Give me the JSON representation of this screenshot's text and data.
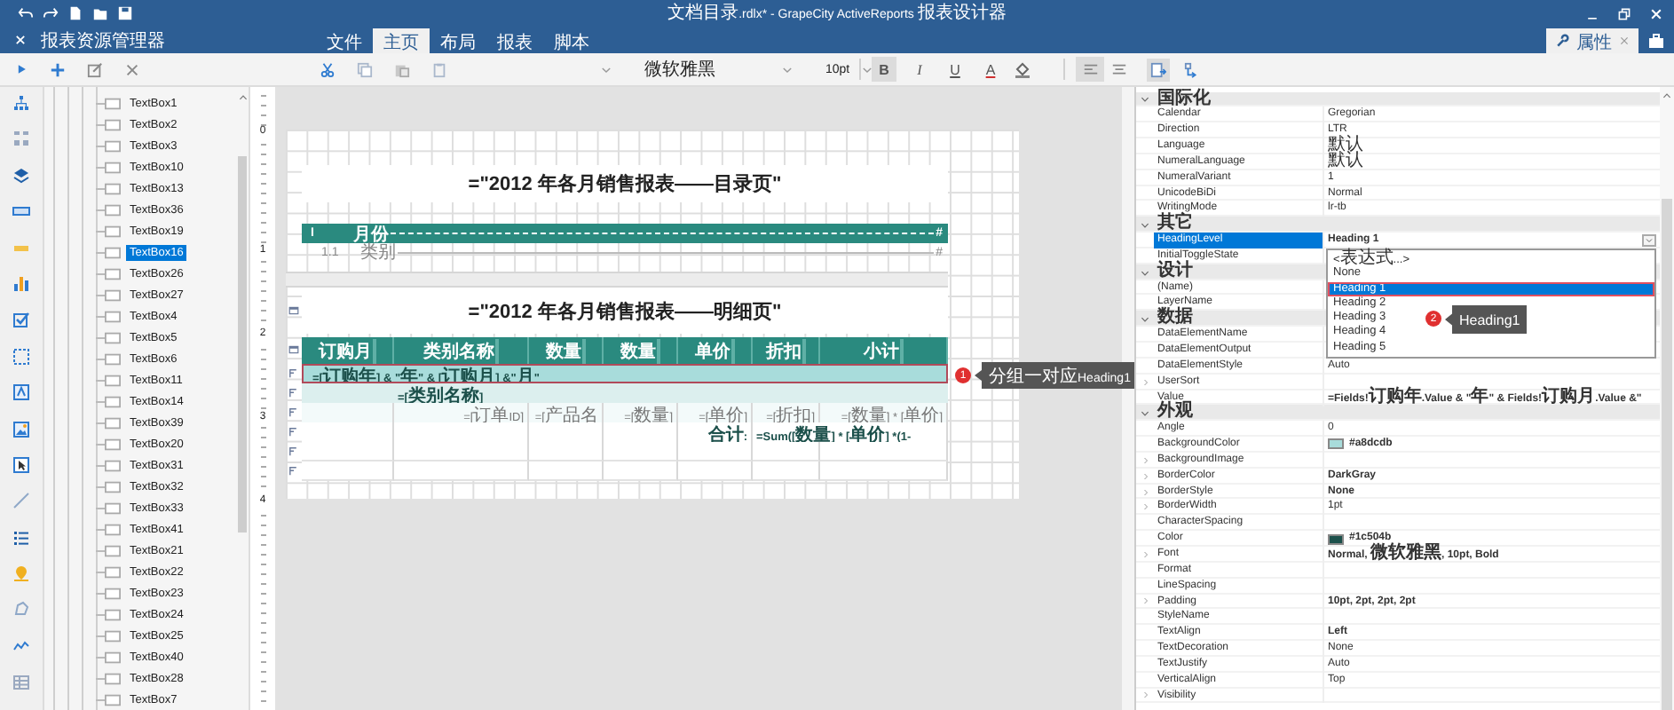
{
  "window": {
    "title": "文档目录.rdlx* - GrapeCity ActiveReports 报表设计器"
  },
  "explorer": {
    "title": "报表资源管理器",
    "items": [
      {
        "label": "TextBox1",
        "selected": false
      },
      {
        "label": "TextBox2",
        "selected": false
      },
      {
        "label": "TextBox3",
        "selected": false
      },
      {
        "label": "TextBox10",
        "selected": false
      },
      {
        "label": "TextBox13",
        "selected": false
      },
      {
        "label": "TextBox36",
        "selected": false
      },
      {
        "label": "TextBox19",
        "selected": false
      },
      {
        "label": "TextBox16",
        "selected": true
      },
      {
        "label": "TextBox26",
        "selected": false
      },
      {
        "label": "TextBox27",
        "selected": false
      },
      {
        "label": "TextBox4",
        "selected": false
      },
      {
        "label": "TextBox5",
        "selected": false
      },
      {
        "label": "TextBox6",
        "selected": false
      },
      {
        "label": "TextBox11",
        "selected": false
      },
      {
        "label": "TextBox14",
        "selected": false
      },
      {
        "label": "TextBox39",
        "selected": false
      },
      {
        "label": "TextBox20",
        "selected": false
      },
      {
        "label": "TextBox31",
        "selected": false
      },
      {
        "label": "TextBox32",
        "selected": false
      },
      {
        "label": "TextBox33",
        "selected": false
      },
      {
        "label": "TextBox41",
        "selected": false
      },
      {
        "label": "TextBox21",
        "selected": false
      },
      {
        "label": "TextBox22",
        "selected": false
      },
      {
        "label": "TextBox23",
        "selected": false
      },
      {
        "label": "TextBox24",
        "selected": false
      },
      {
        "label": "TextBox25",
        "selected": false
      },
      {
        "label": "TextBox40",
        "selected": false
      },
      {
        "label": "TextBox28",
        "selected": false
      },
      {
        "label": "TextBox7",
        "selected": false
      }
    ]
  },
  "ribbon_tabs": [
    {
      "label": "文件",
      "selected": false
    },
    {
      "label": "主页",
      "selected": true
    },
    {
      "label": "布局",
      "selected": false
    },
    {
      "label": "报表",
      "selected": false
    },
    {
      "label": "脚本",
      "selected": false
    }
  ],
  "properties_tab": {
    "label": "属性"
  },
  "toolbar": {
    "font": "微软雅黑",
    "font_size": "10pt",
    "format_buttons": [
      {
        "label": "B",
        "selected": true
      },
      {
        "label": "I",
        "selected": false
      },
      {
        "label": "U",
        "selected": false
      },
      {
        "label": "A",
        "selected": false
      }
    ],
    "align_buttons": [
      {
        "kind": "left",
        "selected": true
      },
      {
        "kind": "center",
        "selected": false
      }
    ]
  },
  "ruler": [
    "0",
    "1",
    "2",
    "3",
    "4"
  ],
  "report": {
    "toc_title": "=\"2012 年各月销售报表——目录页\"",
    "toc_entries": [
      {
        "kind": "heading",
        "level": "I",
        "label": "月份",
        "page": "#"
      },
      {
        "kind": "sub",
        "level": "1.1",
        "label": "类别",
        "page": "#"
      }
    ],
    "detail_title": "=\"2012 年各月销售报表——明细页\"",
    "columns": [
      "订购月",
      "类别名称",
      "数量",
      "数量",
      "单价",
      "折扣",
      "小计"
    ],
    "rows": [
      {
        "kind": "group",
        "selected": true,
        "text": "=[订购年] & \"年\" & [订购月] &\"月\""
      },
      {
        "kind": "subgroup",
        "selected": false,
        "text": "=[类别名称]"
      },
      {
        "kind": "detail",
        "selected": false,
        "cells": [
          "=[订单ID]",
          "=[产品名",
          "=[数量]",
          "=[单价]",
          "=[折扣]",
          "=[数量] * [单价]"
        ]
      },
      {
        "kind": "total",
        "selected": false,
        "label": "合计:",
        "formula": "=Sum([数量] * [单价] *(1-"
      },
      {
        "kind": "empty",
        "selected": false
      },
      {
        "kind": "empty",
        "selected": false
      }
    ]
  },
  "callouts": [
    {
      "number": "1",
      "text": "分组一对应Heading1"
    },
    {
      "number": "2",
      "text": "Heading1"
    }
  ],
  "properties": [
    {
      "kind": "category",
      "label": "国际化",
      "expanded": true
    },
    {
      "kind": "property",
      "name": "Calendar",
      "value": "Gregorian",
      "selected": false,
      "modified": false,
      "expandable": false
    },
    {
      "kind": "property",
      "name": "Direction",
      "value": "LTR",
      "selected": false,
      "modified": false,
      "expandable": false
    },
    {
      "kind": "property",
      "name": "Language",
      "value": "默认",
      "selected": false,
      "modified": false,
      "expandable": false
    },
    {
      "kind": "property",
      "name": "NumeralLanguage",
      "value": "默认",
      "selected": false,
      "modified": false,
      "expandable": false
    },
    {
      "kind": "property",
      "name": "NumeralVariant",
      "value": "1",
      "selected": false,
      "modified": false,
      "expandable": false
    },
    {
      "kind": "property",
      "name": "UnicodeBiDi",
      "value": "Normal",
      "selected": false,
      "modified": false,
      "expandable": false
    },
    {
      "kind": "property",
      "name": "WritingMode",
      "value": "lr-tb",
      "selected": false,
      "modified": false,
      "expandable": false
    },
    {
      "kind": "category",
      "label": "其它",
      "expanded": true
    },
    {
      "kind": "property",
      "name": "HeadingLevel",
      "value": "Heading 1",
      "selected": true,
      "modified": true,
      "expandable": false
    },
    {
      "kind": "property",
      "name": "InitialToggleState",
      "selected": false,
      "expandable": false
    },
    {
      "kind": "category",
      "label": "设计",
      "expanded": true
    },
    {
      "kind": "property",
      "name": "(Name)",
      "selected": false,
      "expandable": false
    },
    {
      "kind": "property",
      "name": "LayerName",
      "selected": false,
      "expandable": false
    },
    {
      "kind": "category",
      "label": "数据",
      "expanded": true
    },
    {
      "kind": "property",
      "name": "DataElementName",
      "selected": false,
      "expandable": false
    },
    {
      "kind": "property",
      "name": "DataElementOutput",
      "selected": false,
      "expandable": false
    },
    {
      "kind": "property",
      "name": "DataElementStyle",
      "value": "Auto",
      "selected": false,
      "modified": false,
      "expandable": false
    },
    {
      "kind": "property",
      "name": "UserSort",
      "selected": false,
      "expandable": true
    },
    {
      "kind": "property",
      "name": "Value",
      "value": "=Fields!订购年.Value & \"年\" & Fields!订购月.Value &\"",
      "selected": false,
      "modified": true,
      "expandable": false
    },
    {
      "kind": "category",
      "label": "外观",
      "expanded": true
    },
    {
      "kind": "property",
      "name": "Angle",
      "value": "0",
      "selected": false,
      "modified": false,
      "expandable": false
    },
    {
      "kind": "color",
      "name": "BackgroundColor",
      "value": "#a8dcdb",
      "selected": false,
      "modified": true,
      "expandable": false
    },
    {
      "kind": "property",
      "name": "BackgroundImage",
      "selected": false,
      "expandable": true
    },
    {
      "kind": "property",
      "name": "BorderColor",
      "value": "DarkGray",
      "selected": false,
      "modified": true,
      "expandable": true
    },
    {
      "kind": "property",
      "name": "BorderStyle",
      "value": "None",
      "selected": false,
      "modified": true,
      "expandable": true
    },
    {
      "kind": "property",
      "name": "BorderWidth",
      "value": "1pt",
      "selected": false,
      "modified": false,
      "expandable": true
    },
    {
      "kind": "property",
      "name": "CharacterSpacing",
      "selected": false,
      "expandable": false
    },
    {
      "kind": "color",
      "name": "Color",
      "value": "#1c504b",
      "selected": false,
      "modified": true,
      "expandable": false
    },
    {
      "kind": "property",
      "name": "Font",
      "value": "Normal, 微软雅黑, 10pt, Bold",
      "selected": false,
      "modified": true,
      "expandable": true
    },
    {
      "kind": "property",
      "name": "Format",
      "selected": false,
      "expandable": false
    },
    {
      "kind": "property",
      "name": "LineSpacing",
      "selected": false,
      "expandable": false
    },
    {
      "kind": "property",
      "name": "Padding",
      "value": "10pt, 2pt, 2pt, 2pt",
      "selected": false,
      "modified": true,
      "expandable": true
    },
    {
      "kind": "property",
      "name": "StyleName",
      "selected": false,
      "expandable": false
    },
    {
      "kind": "property",
      "name": "TextAlign",
      "value": "Left",
      "selected": false,
      "modified": true,
      "expandable": false
    },
    {
      "kind": "property",
      "name": "TextDecoration",
      "value": "None",
      "selected": false,
      "modified": false,
      "expandable": false
    },
    {
      "kind": "property",
      "name": "TextJustify",
      "value": "Auto",
      "selected": false,
      "modified": false,
      "expandable": false
    },
    {
      "kind": "property",
      "name": "VerticalAlign",
      "value": "Top",
      "selected": false,
      "modified": false,
      "expandable": false
    },
    {
      "kind": "property",
      "name": "Visibility",
      "selected": false,
      "expandable": true
    }
  ],
  "heading_dropdown": {
    "options": [
      {
        "label": "<表达式...>",
        "selected": false
      },
      {
        "label": "None",
        "selected": false
      },
      {
        "label": "Heading 1",
        "selected": true
      },
      {
        "label": "Heading 2",
        "selected": false
      },
      {
        "label": "Heading 3",
        "selected": false
      },
      {
        "label": "Heading 4",
        "selected": false
      },
      {
        "label": "Heading 5",
        "selected": false
      }
    ]
  }
}
